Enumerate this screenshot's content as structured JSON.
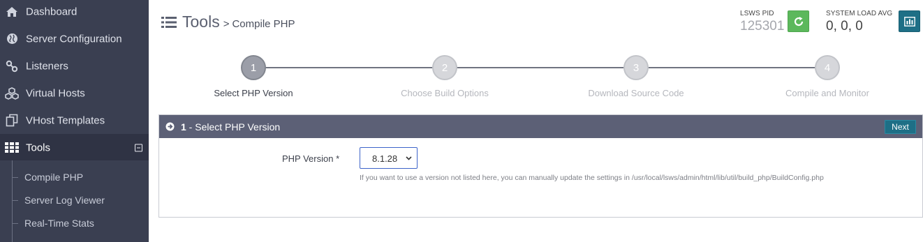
{
  "sidebar": {
    "items": [
      {
        "label": "Dashboard",
        "icon": "home-icon"
      },
      {
        "label": "Server Configuration",
        "icon": "globe-icon"
      },
      {
        "label": "Listeners",
        "icon": "link-icon"
      },
      {
        "label": "Virtual Hosts",
        "icon": "cubes-icon"
      },
      {
        "label": "VHost Templates",
        "icon": "copy-icon"
      },
      {
        "label": "Tools",
        "icon": "grid-icon"
      }
    ],
    "sub_items": [
      {
        "label": "Compile PHP"
      },
      {
        "label": "Server Log Viewer"
      },
      {
        "label": "Real-Time Stats"
      }
    ]
  },
  "header": {
    "title": "Tools",
    "separator": ">",
    "subtitle": "Compile PHP",
    "lsws_pid_label": "LSWS PID",
    "lsws_pid_value": "125301",
    "load_label": "SYSTEM LOAD AVG",
    "load_value": "0, 0, 0"
  },
  "steps": [
    {
      "number": "1",
      "label": "Select PHP Version",
      "active": true
    },
    {
      "number": "2",
      "label": "Choose Build Options",
      "active": false
    },
    {
      "number": "3",
      "label": "Download Source Code",
      "active": false
    },
    {
      "number": "4",
      "label": "Compile and Monitor",
      "active": false
    }
  ],
  "panel": {
    "number": "1",
    "title": " - Select PHP Version",
    "next_label": "Next",
    "field_label": "PHP Version *",
    "selected_version": "8.1.28",
    "help_text": "If you want to use a version not listed here, you can manually update the settings in /usr/local/lsws/admin/html/lib/util/build_php/BuildConfig.php"
  },
  "colors": {
    "sidebar_bg": "#3a3f51",
    "panel_header_bg": "#5c6076",
    "restart_button": "#5cb85c",
    "stats_button": "#1e6f86",
    "accent": "#1e6f86"
  }
}
